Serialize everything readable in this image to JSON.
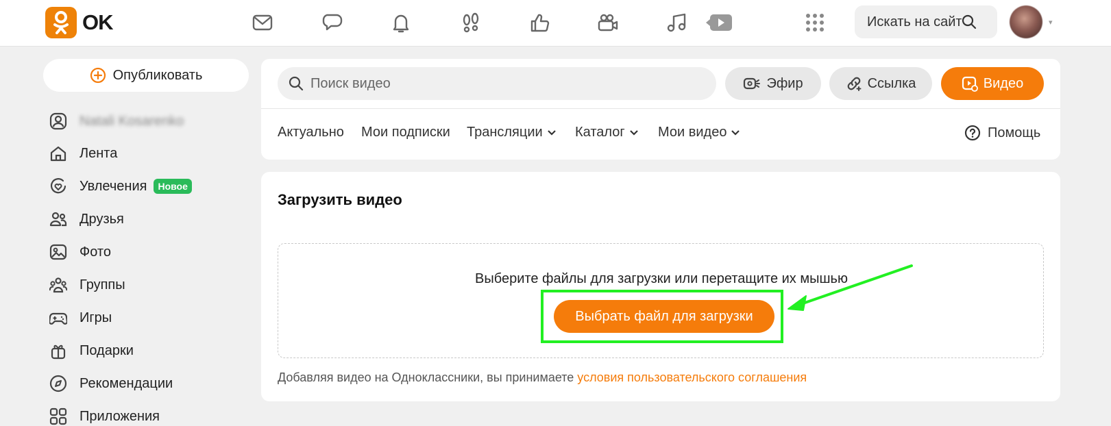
{
  "header": {
    "logo_text": "OK",
    "site_search_placeholder": "Искать на сайте"
  },
  "sidebar": {
    "publish_label": "Опубликовать",
    "profile_name": "Natali Kosarenko",
    "items": [
      {
        "label": "Лента",
        "icon": "home-icon"
      },
      {
        "label": "Увлечения",
        "icon": "hobbies-icon",
        "badge": "Новое"
      },
      {
        "label": "Друзья",
        "icon": "friends-icon"
      },
      {
        "label": "Фото",
        "icon": "photo-icon"
      },
      {
        "label": "Группы",
        "icon": "groups-icon"
      },
      {
        "label": "Игры",
        "icon": "games-icon"
      },
      {
        "label": "Подарки",
        "icon": "gift-icon"
      },
      {
        "label": "Рекомендации",
        "icon": "compass-icon"
      },
      {
        "label": "Приложения",
        "icon": "apps-icon"
      }
    ]
  },
  "video": {
    "search_placeholder": "Поиск видео",
    "live_label": "Эфир",
    "link_label": "Ссылка",
    "video_label": "Видео",
    "tabs": {
      "actual": "Актуально",
      "subscriptions": "Мои подписки",
      "streams": "Трансляции",
      "catalog": "Каталог",
      "my_videos": "Мои видео",
      "help": "Помощь"
    }
  },
  "upload": {
    "title": "Загрузить видео",
    "drop_text": "Выберите файлы для загрузки или перетащите их мышью",
    "choose_button": "Выбрать файл для загрузки",
    "terms_prefix": "Добавляя видео на Одноклассники, вы принимаете ",
    "terms_link": "условия пользовательского соглашения"
  },
  "colors": {
    "accent": "#f57c0b",
    "highlight": "#22f022",
    "badge": "#2abb5a"
  }
}
